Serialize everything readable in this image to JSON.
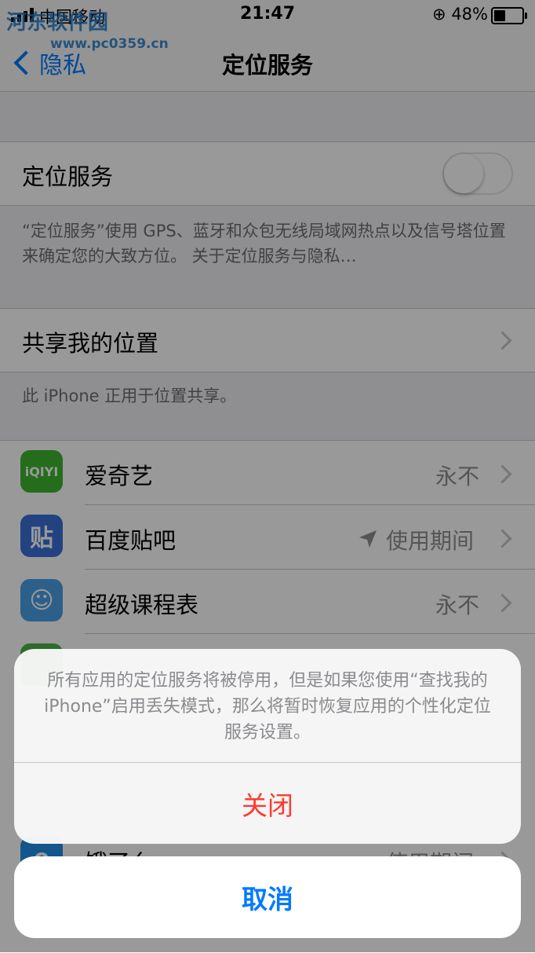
{
  "status_bar": {
    "carrier": "中国移动",
    "time": "21:47",
    "battery": "48%",
    "battery_level": 0.48
  },
  "watermark": {
    "name": "河东软件园",
    "url": "www.pc0359.cn"
  },
  "nav": {
    "back_label": "隐私",
    "title": "定位服务"
  },
  "location_services": {
    "label": "定位服务",
    "enabled": false,
    "description": "“定位服务”使用 GPS、蓝牙和众包无线局域网热点以及信号塔位置来确定您的大致方位。 关于定位服务与隐私…"
  },
  "share_location": {
    "label": "共享我的位置",
    "footnote": "此 iPhone 正用于位置共享。"
  },
  "apps": [
    {
      "name": "爱奇艺",
      "value": "永不",
      "icon_text": "iQIYI",
      "color": "#3fb52f"
    },
    {
      "name": "百度贴吧",
      "value": "使用期间",
      "icon_text": "贴",
      "color": "#3a6fd8",
      "location_arrow": true
    },
    {
      "name": "超级课程表",
      "value": "永不",
      "icon_text": "☺",
      "color": "#4aa0e6"
    },
    {
      "name": "饿了么",
      "value": "使用期间",
      "icon_text": "e",
      "color": "#1e8fe8"
    }
  ],
  "alert": {
    "message": "所有应用的定位服务将被停用，但是如果您使用“查找我的 iPhone”启用丢失模式，那么将暂时恢复应用的个性化定位服务设置。",
    "destructive_label": "关闭",
    "cancel_label": "取消",
    "destructive_color": "#ff3b30",
    "cancel_color": "#007aff"
  }
}
